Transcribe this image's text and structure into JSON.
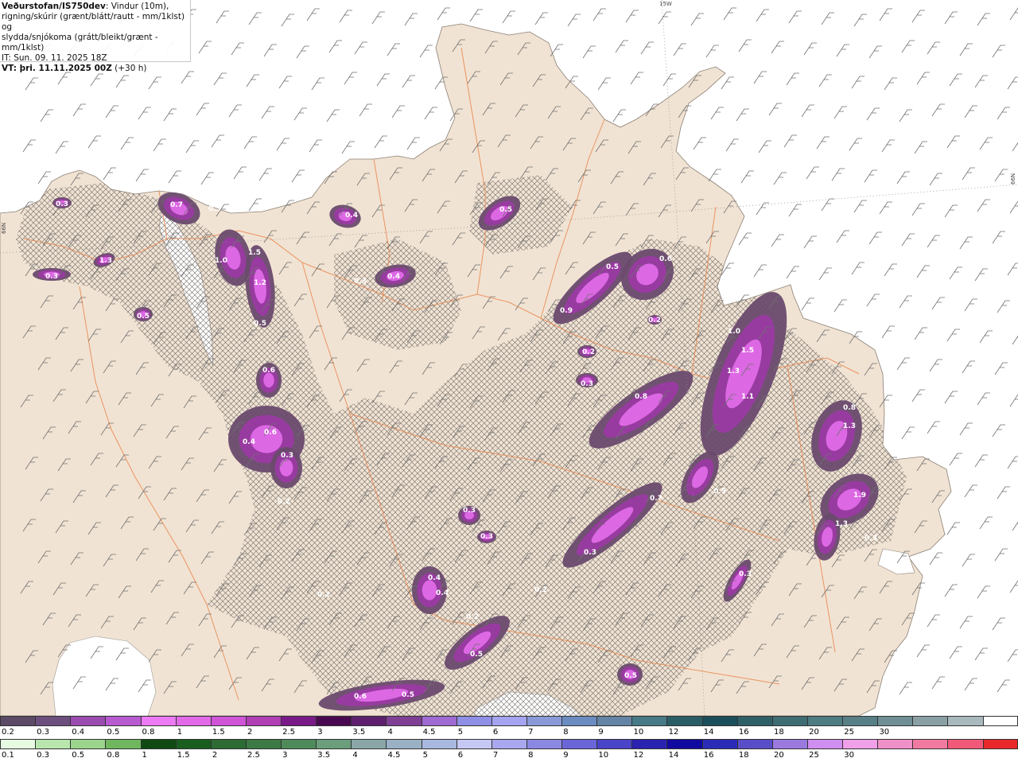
{
  "header": {
    "org": "Veðurstofan/IS750dev",
    "line1_rest": ": Vindur (10m),",
    "line2": "rigning/skúrir (grænt/blátt/rautt - mm/1klst) og",
    "line3": "slydda/snjókoma (grátt/bleikt/grænt - mm/1klst)",
    "it": "IT: Sun. 09. 11. 2025 18Z",
    "vt_bold": "VT: þri. 11.11.2025 00Z",
    "vt_rest": " (+30 h)"
  },
  "grid_labels": {
    "lon": "15W",
    "lat_left": "66N",
    "lat_right": "66N"
  },
  "colors": {
    "sea": "#ffffff",
    "land": "#f1e3d3",
    "roads": "#e8874f",
    "precip_light": "#6a4a6e",
    "precip_mid": "#9a3aa2",
    "precip_high": "#e06ae8"
  },
  "precip_labels": [
    {
      "text": "0.3"
    },
    {
      "text": "0.7"
    },
    {
      "text": "0.5"
    },
    {
      "text": "1.3"
    },
    {
      "text": "0.3"
    },
    {
      "text": "1.0"
    },
    {
      "text": "1.5"
    },
    {
      "text": "1.2"
    },
    {
      "text": "0.5"
    },
    {
      "text": "0.6"
    },
    {
      "text": "0.4"
    },
    {
      "text": "0.5"
    },
    {
      "text": "0.3"
    },
    {
      "text": "0.4"
    },
    {
      "text": "0.5"
    },
    {
      "text": "0.5"
    },
    {
      "text": "0.9"
    },
    {
      "text": "0.2"
    },
    {
      "text": "0.2"
    },
    {
      "text": "0.3"
    },
    {
      "text": "1.0"
    },
    {
      "text": "1.5"
    },
    {
      "text": "1.3"
    },
    {
      "text": "1.1"
    },
    {
      "text": "0.8"
    },
    {
      "text": "0.6"
    },
    {
      "text": "0.4"
    },
    {
      "text": "0.6"
    },
    {
      "text": "0.3"
    },
    {
      "text": "0.2"
    },
    {
      "text": "0.8"
    },
    {
      "text": "1.3"
    },
    {
      "text": "1.9"
    },
    {
      "text": "1.3"
    },
    {
      "text": "0.3"
    },
    {
      "text": "0.7"
    },
    {
      "text": "0.3"
    },
    {
      "text": "0.5"
    },
    {
      "text": "0.3"
    },
    {
      "text": "0.3"
    },
    {
      "text": "0.3"
    },
    {
      "text": "0.4"
    },
    {
      "text": "0.4"
    },
    {
      "text": "0.2"
    },
    {
      "text": "0.2"
    },
    {
      "text": "0.5"
    },
    {
      "text": "0.5"
    },
    {
      "text": "0.5"
    },
    {
      "text": "0.6"
    },
    {
      "text": "0.2"
    }
  ],
  "legend_snow": {
    "colors": [
      "#5c4a66",
      "#6c4f7f",
      "#9a4cb0",
      "#b85ad0",
      "#ec7af4",
      "#e26ae9",
      "#cf54d6",
      "#b03eb5",
      "#7a1a88",
      "#4a0850",
      "#5e1f6e",
      "#7f3f95",
      "#9f6ad2",
      "#8f8fe6",
      "#a4a4f0",
      "#8a9ad8",
      "#6b8cc0",
      "#6384a4",
      "#467a86",
      "#2a5e66",
      "#1a4e5a",
      "#2f6067",
      "#3e6d73",
      "#4d7c82",
      "#597f86",
      "#6f8f95",
      "#8aa0a5",
      "#a9b9bd",
      "#ffffff"
    ],
    "labels": [
      "0.2",
      "0.3",
      "0.4",
      "0.5",
      "0.8",
      "1",
      "1.5",
      "2",
      "2.5",
      "3",
      "3.5",
      "4",
      "4.5",
      "5",
      "6",
      "7",
      "8",
      "9",
      "10",
      "12",
      "14",
      "16",
      "18",
      "20",
      "25",
      "30"
    ]
  },
  "legend_rain": {
    "colors": [
      "#e6fbe2",
      "#b8e6ad",
      "#9bd48d",
      "#6fb65e",
      "#0f4a12",
      "#195e1f",
      "#2c6b33",
      "#3c7a45",
      "#4f8a5b",
      "#6a9e7c",
      "#8aa6a6",
      "#9ab0c4",
      "#a8b8de",
      "#c6c8f4",
      "#a9a8ee",
      "#8b88e2",
      "#6b66d8",
      "#4a44c8",
      "#2a22b0",
      "#110aa0",
      "#2b2cb6",
      "#5a4ec8",
      "#9b7ae0",
      "#d08ef0",
      "#f0a0e8",
      "#f090c8",
      "#f07aa0",
      "#f05a78",
      "#e8282a"
    ],
    "labels": [
      "0.1",
      "0.3",
      "0.5",
      "0.8",
      "1",
      "1.5",
      "2",
      "2.5",
      "3",
      "3.5",
      "4",
      "4.5",
      "5",
      "6",
      "7",
      "8",
      "9",
      "10",
      "12",
      "14",
      "16",
      "18",
      "20",
      "25",
      "30"
    ]
  }
}
